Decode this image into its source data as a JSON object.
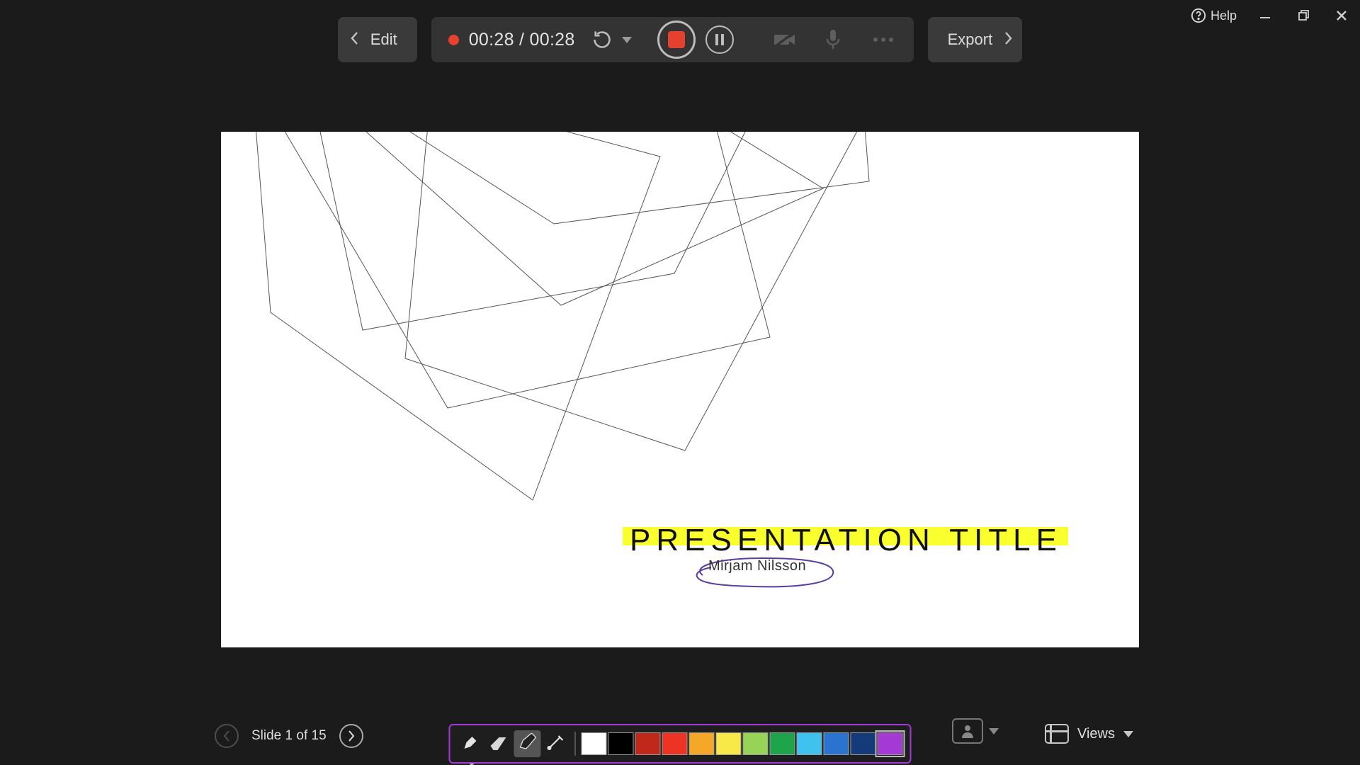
{
  "window": {
    "help_label": "Help"
  },
  "toolbar": {
    "edit_label": "Edit",
    "export_label": "Export",
    "timer_current": "00:28",
    "timer_total": "00:28"
  },
  "slide": {
    "title": "PRESENTATION TITLE",
    "author": "Mirjam Nilsson"
  },
  "footer": {
    "slide_indicator": "Slide 1 of 15",
    "views_label": "Views",
    "progress": {
      "current": 1,
      "total": 15
    }
  },
  "ink_palette": [
    {
      "name": "white",
      "hex": "#ffffff"
    },
    {
      "name": "black",
      "hex": "#000000"
    },
    {
      "name": "dark-red",
      "hex": "#c0281a"
    },
    {
      "name": "red",
      "hex": "#ed3323"
    },
    {
      "name": "orange",
      "hex": "#f5a727"
    },
    {
      "name": "yellow",
      "hex": "#f8e948"
    },
    {
      "name": "light-green",
      "hex": "#97d357"
    },
    {
      "name": "green",
      "hex": "#1ea54c"
    },
    {
      "name": "light-blue",
      "hex": "#3fc2ee"
    },
    {
      "name": "blue",
      "hex": "#2a74d0"
    },
    {
      "name": "dark-blue",
      "hex": "#153a7a"
    },
    {
      "name": "purple",
      "hex": "#a539d6"
    }
  ],
  "ink_tools": [
    {
      "name": "pen"
    },
    {
      "name": "eraser"
    },
    {
      "name": "highlighter",
      "selected": true
    },
    {
      "name": "laser"
    }
  ],
  "selected_swatch": "purple"
}
